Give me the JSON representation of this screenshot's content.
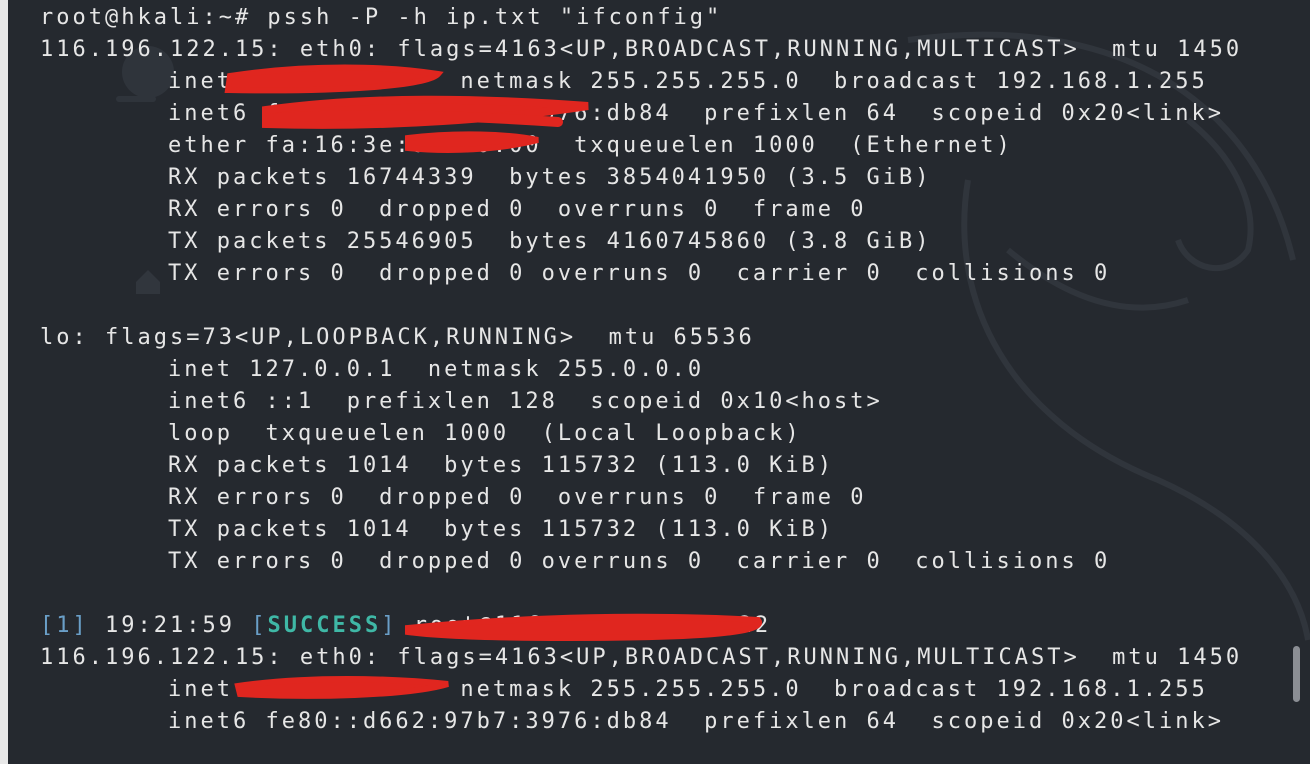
{
  "terminal": {
    "lines": [
      "root@hkali:~# pssh -P -h ip.txt \"ifconfig\"",
      "116.196.122.15: eth0: flags=4163<UP,BROADCAST,RUNNING,MULTICAST>  mtu 1450",
      "inet              netmask 255.255.255.0  broadcast 192.168.1.255",
      "inet6 fe80::d662:97b7:3976:db84  prefixlen 64  scopeid 0x20<link>",
      "ether fa:16:3e:80:00:00  txqueuelen 1000  (Ethernet)",
      "RX packets 16744339  bytes 3854041950 (3.5 GiB)",
      "RX errors 0  dropped 0  overruns 0  frame 0",
      "TX packets 25546905  bytes 4160745860 (3.8 GiB)",
      "TX errors 0  dropped 0 overruns 0  carrier 0  collisions 0",
      "lo: flags=73<UP,LOOPBACK,RUNNING>  mtu 65536",
      "inet 127.0.0.1  netmask 255.0.0.0",
      "inet6 ::1  prefixlen 128  scopeid 0x10<host>",
      "loop  txqueuelen 1000  (Local Loopback)",
      "RX packets 1014  bytes 115732 (113.0 KiB)",
      "RX errors 0  dropped 0  overruns 0  frame 0",
      "TX packets 1014  bytes 115732 (113.0 KiB)",
      "TX errors 0  dropped 0 overruns 0  carrier 0  collisions 0",
      "116.196.122.15: eth0: flags=4163<UP,BROADCAST,RUNNING,MULTICAST>  mtu 1450",
      "inet              netmask 255.255.255.0  broadcast 192.168.1.255",
      "inet6 fe80::d662:97b7:3976:db84  prefixlen 64  scopeid 0x20<link>"
    ],
    "status": {
      "index": "1",
      "time": "19:21:59",
      "result": "SUCCESS",
      "host": "root@116.196.122.15:22"
    }
  },
  "colors": {
    "background": "#25292f",
    "text": "#e6e6e6",
    "bracket": "#6a9fc8",
    "success": "#3fb8a6",
    "redaction": "#e0261f"
  },
  "icons": [
    "kali-dragon-watermark-icon",
    "home-icon"
  ]
}
